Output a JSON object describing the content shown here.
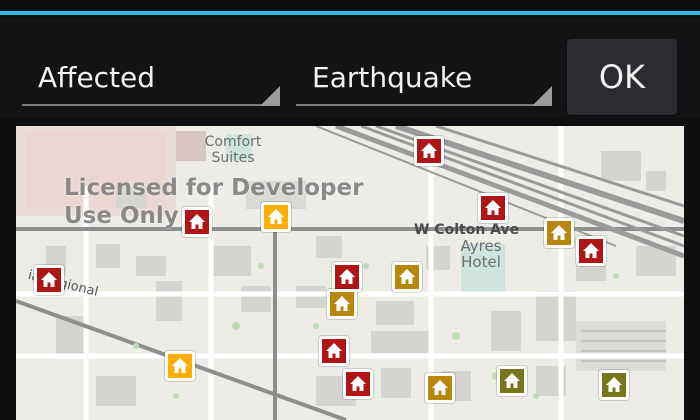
{
  "toolbar": {
    "status_spinner": {
      "value": "Affected"
    },
    "incident_spinner": {
      "value": "Earthquake"
    },
    "ok_label": "OK"
  },
  "map": {
    "watermark": "Licensed for Developer\nUse Only",
    "labels": {
      "comfort_suites": "Comfort\nSuites",
      "ayres_hotel": "Ayres\nHotel",
      "w_colton_ave": "W Colton Ave",
      "regional": "ia Regional"
    },
    "markers": [
      {
        "status": "severe"
      },
      {
        "status": "severe"
      },
      {
        "status": "severe"
      },
      {
        "status": "severe"
      },
      {
        "status": "severe"
      },
      {
        "status": "severe"
      },
      {
        "status": "severe"
      },
      {
        "status": "severe"
      },
      {
        "status": "moderate"
      },
      {
        "status": "moderate"
      },
      {
        "status": "moderate"
      },
      {
        "status": "moderate"
      },
      {
        "status": "minor"
      },
      {
        "status": "minor"
      },
      {
        "status": "light"
      },
      {
        "status": "light"
      }
    ],
    "marker_icon": "house-icon"
  },
  "colors": {
    "accent": "#33b5e5",
    "severe": "#b01515",
    "moderate": "#b8860b",
    "minor": "#ffae00",
    "light": "#77761c"
  }
}
